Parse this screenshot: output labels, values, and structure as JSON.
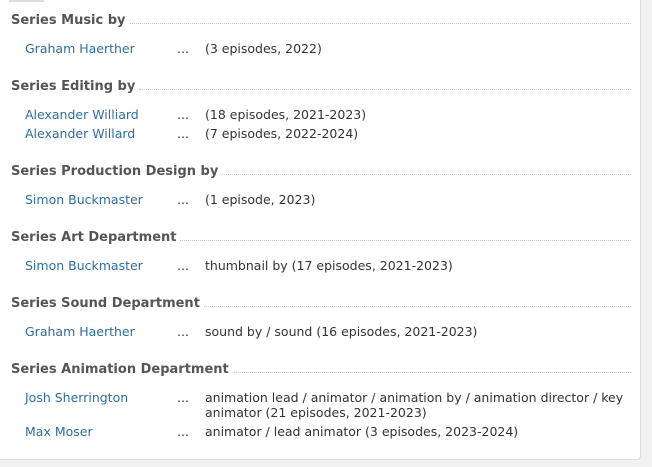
{
  "sections": [
    {
      "title": "Series Music by",
      "credits": [
        {
          "name": "Graham Haerther",
          "ellipsis": "...",
          "role": "(3 episodes, 2022)"
        }
      ]
    },
    {
      "title": "Series Editing by",
      "credits": [
        {
          "name": "Alexander Williard",
          "ellipsis": "...",
          "role": "(18 episodes, 2021-2023)"
        },
        {
          "name": "Alexander Willard",
          "ellipsis": "...",
          "role": "(7 episodes, 2022-2024)"
        }
      ]
    },
    {
      "title": "Series Production Design by",
      "credits": [
        {
          "name": "Simon Buckmaster",
          "ellipsis": "...",
          "role": "(1 episode, 2023)"
        }
      ]
    },
    {
      "title": "Series Art Department",
      "credits": [
        {
          "name": "Simon Buckmaster",
          "ellipsis": "...",
          "role": "thumbnail by (17 episodes, 2021-2023)"
        }
      ]
    },
    {
      "title": "Series Sound Department",
      "credits": [
        {
          "name": "Graham Haerther",
          "ellipsis": "...",
          "role": "sound by / sound (16 episodes, 2021-2023)"
        }
      ]
    },
    {
      "title": "Series Animation Department",
      "credits": [
        {
          "name": "Josh Sherrington",
          "ellipsis": "...",
          "role": "animation lead / animator / animation by / animation director / key animator (21 episodes, 2021-2023)"
        },
        {
          "name": "Max Moser",
          "ellipsis": "...",
          "role": "animator / lead animator (3 episodes, 2023-2024)"
        }
      ]
    }
  ]
}
